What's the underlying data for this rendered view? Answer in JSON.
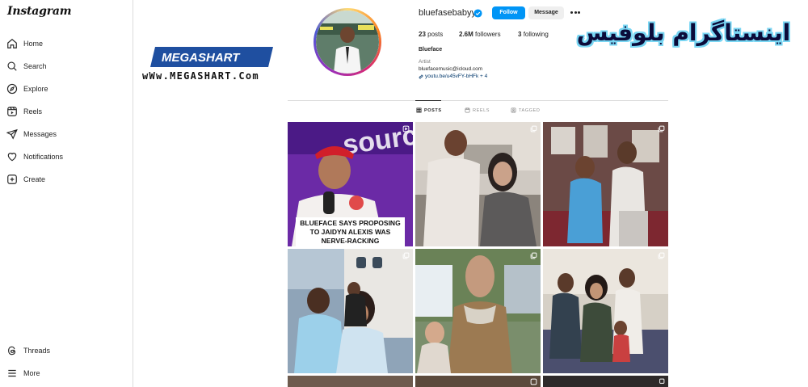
{
  "app": {
    "brand": "Instagram"
  },
  "sidebar": {
    "items": [
      {
        "label": "Home",
        "icon": "home-icon"
      },
      {
        "label": "Search",
        "icon": "search-icon"
      },
      {
        "label": "Explore",
        "icon": "compass-icon"
      },
      {
        "label": "Reels",
        "icon": "reels-icon"
      },
      {
        "label": "Messages",
        "icon": "paper-plane-icon"
      },
      {
        "label": "Notifications",
        "icon": "heart-icon"
      },
      {
        "label": "Create",
        "icon": "plus-square-icon"
      }
    ],
    "bottom_items": [
      {
        "label": "Threads",
        "icon": "threads-icon"
      },
      {
        "label": "More",
        "icon": "hamburger-icon"
      }
    ]
  },
  "watermark": {
    "logo_text": "MEGASHART",
    "site": "wWw.MEGASHART.Com",
    "persian_title": "اینستاگرام بلوفیس"
  },
  "profile": {
    "username": "bluefasebabyy",
    "verified": true,
    "follow_label": "Follow",
    "message_label": "Message",
    "posts_count": "23",
    "posts_label": "posts",
    "followers_count": "2.6M",
    "followers_label": "followers",
    "following_count": "3",
    "following_label": "following",
    "full_name": "Blueface",
    "category": "Artist",
    "email": "bluefacemusic@icloud.com",
    "link": "youtu.be/u45vFY-bHFk + 4"
  },
  "tabs": [
    {
      "label": "POSTS",
      "active": true,
      "icon": "grid-icon"
    },
    {
      "label": "REELS",
      "active": false,
      "icon": "reels-icon"
    },
    {
      "label": "TAGGED",
      "active": false,
      "icon": "tagged-icon"
    }
  ],
  "posts": [
    {
      "caption": "BLUEFACE SAYS PROPOSING TO JAIDYN ALEXIS WAS NERVE-RACKING",
      "type": "clip-icon"
    },
    {
      "caption": "",
      "type": "carousel-icon"
    },
    {
      "caption": "",
      "type": "carousel-icon"
    },
    {
      "caption": "",
      "type": "carousel-icon"
    },
    {
      "caption": "",
      "type": "carousel-icon"
    },
    {
      "caption": "",
      "type": "carousel-icon"
    }
  ],
  "colors": {
    "accent": "#0095f6",
    "link": "#00376b",
    "persian_title_fill": "#0b0b3a",
    "persian_title_outline": "#79d6f3",
    "megashart_blue": "#1f4fa0"
  }
}
